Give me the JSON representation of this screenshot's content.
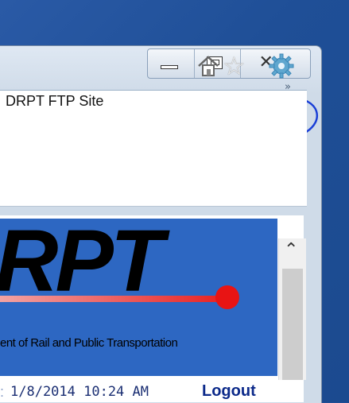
{
  "window": {
    "tab_title": "DRPT FTP Site",
    "tab_overflow": "»",
    "caption": {
      "close_glyph": "☒"
    }
  },
  "icons": [
    "home-icon",
    "star-icon",
    "gear-icon"
  ],
  "annotation": {
    "color": "#1a3fd6"
  },
  "page": {
    "banner_title": "RPT",
    "banner_subtitle": "ent of Rail and Public Transportation",
    "timestamp": "1/8/2014 10:24 AM",
    "logout_label": "Logout",
    "lead_mark": ":"
  },
  "scrollbar": {
    "up_glyph": "⌃"
  }
}
